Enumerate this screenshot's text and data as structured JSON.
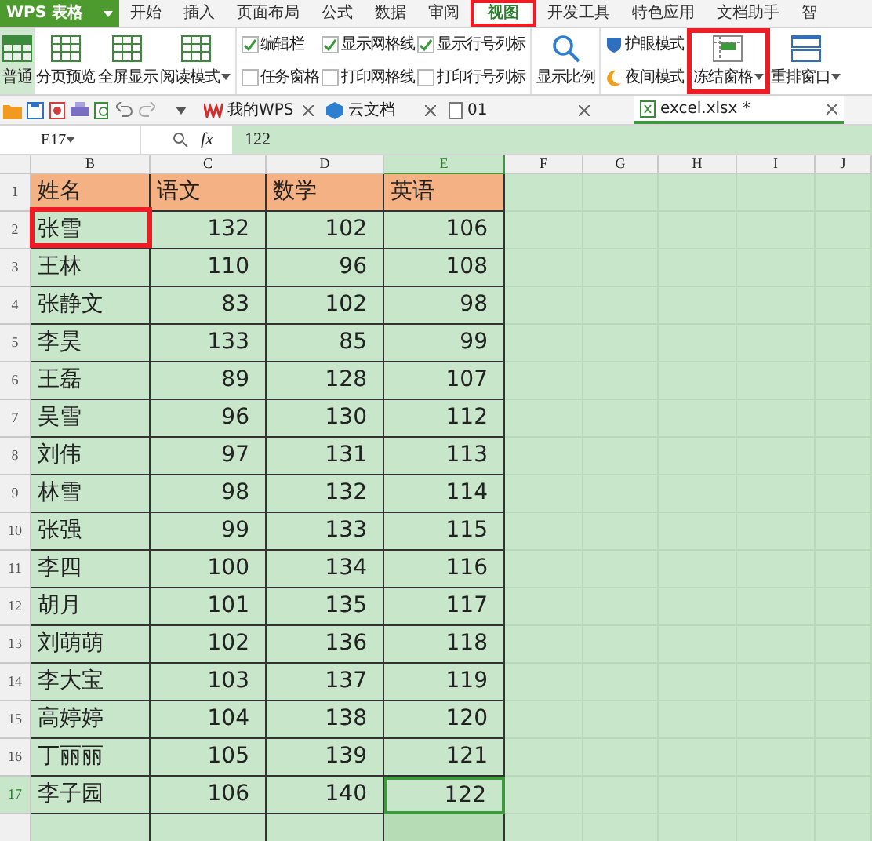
{
  "app": {
    "title": "WPS 表格"
  },
  "ribbon_tabs": [
    {
      "label": "开始",
      "selected": false
    },
    {
      "label": "插入",
      "selected": false
    },
    {
      "label": "页面布局",
      "selected": false
    },
    {
      "label": "公式",
      "selected": false
    },
    {
      "label": "数据",
      "selected": false
    },
    {
      "label": "审阅",
      "selected": false
    },
    {
      "label": "视图",
      "selected": true
    },
    {
      "label": "开发工具",
      "selected": false
    },
    {
      "label": "特色应用",
      "selected": false
    },
    {
      "label": "文档助手",
      "selected": false
    },
    {
      "label": "智",
      "selected": false
    }
  ],
  "ribbon": {
    "view_buttons": [
      {
        "label": "普通",
        "selected": true,
        "dropdown": false
      },
      {
        "label": "分页预览",
        "selected": false,
        "dropdown": false
      },
      {
        "label": "全屏显示",
        "selected": false,
        "dropdown": false
      },
      {
        "label": "阅读模式",
        "selected": false,
        "dropdown": true
      }
    ],
    "checkboxes": [
      {
        "label": "编辑栏",
        "checked": true
      },
      {
        "label": "任务窗格",
        "checked": false
      },
      {
        "label": "显示网格线",
        "checked": true
      },
      {
        "label": "打印网格线",
        "checked": false
      },
      {
        "label": "显示行号列标",
        "checked": true
      },
      {
        "label": "打印行号列标",
        "checked": false
      }
    ],
    "zoom_button": {
      "label": "显示比例"
    },
    "modes": [
      {
        "label": "护眼模式",
        "kind": "eye"
      },
      {
        "label": "夜间模式",
        "kind": "night"
      }
    ],
    "freeze_button": {
      "label": "冻结窗格"
    },
    "arrange_button": {
      "label": "重排窗口"
    }
  },
  "doc_tabs": [
    {
      "label": "我的WPS",
      "kind": "wps",
      "selected": false
    },
    {
      "label": "云文档",
      "kind": "cloud",
      "selected": false
    },
    {
      "label": "01",
      "kind": "file",
      "selected": false
    },
    {
      "label": "excel.xlsx *",
      "kind": "sheet",
      "selected": true
    }
  ],
  "formula_bar": {
    "cell": "E17",
    "function_label": "fx",
    "value": "122"
  },
  "sheet": {
    "columns": [
      {
        "label": "B",
        "selected": false
      },
      {
        "label": "C",
        "selected": false
      },
      {
        "label": "D",
        "selected": false
      },
      {
        "label": "E",
        "selected": true
      },
      {
        "label": "F",
        "selected": false
      },
      {
        "label": "G",
        "selected": false
      },
      {
        "label": "H",
        "selected": false
      },
      {
        "label": "I",
        "selected": false
      },
      {
        "label": "J",
        "selected": false
      }
    ],
    "rows": [
      {
        "number": "1",
        "selected": false,
        "kind": "header",
        "cells": [
          "姓名",
          "语文",
          "数学",
          "英语"
        ]
      },
      {
        "number": "2",
        "selected": false,
        "kind": "data",
        "cells": [
          "张雪",
          "132",
          "102",
          "106"
        ]
      },
      {
        "number": "3",
        "selected": false,
        "kind": "data",
        "cells": [
          "王林",
          "110",
          "96",
          "108"
        ]
      },
      {
        "number": "4",
        "selected": false,
        "kind": "data",
        "cells": [
          "张静文",
          "83",
          "102",
          "98"
        ]
      },
      {
        "number": "5",
        "selected": false,
        "kind": "data",
        "cells": [
          "李昊",
          "133",
          "85",
          "99"
        ]
      },
      {
        "number": "6",
        "selected": false,
        "kind": "data",
        "cells": [
          "王磊",
          "89",
          "128",
          "107"
        ]
      },
      {
        "number": "7",
        "selected": false,
        "kind": "data",
        "cells": [
          "吴雪",
          "96",
          "130",
          "112"
        ]
      },
      {
        "number": "8",
        "selected": false,
        "kind": "data",
        "cells": [
          "刘伟",
          "97",
          "131",
          "113"
        ]
      },
      {
        "number": "9",
        "selected": false,
        "kind": "data",
        "cells": [
          "林雪",
          "98",
          "132",
          "114"
        ]
      },
      {
        "number": "10",
        "selected": false,
        "kind": "data",
        "cells": [
          "张强",
          "99",
          "133",
          "115"
        ]
      },
      {
        "number": "11",
        "selected": false,
        "kind": "data",
        "cells": [
          "李四",
          "100",
          "134",
          "116"
        ]
      },
      {
        "number": "12",
        "selected": false,
        "kind": "data",
        "cells": [
          "胡月",
          "101",
          "135",
          "117"
        ]
      },
      {
        "number": "13",
        "selected": false,
        "kind": "data",
        "cells": [
          "刘萌萌",
          "102",
          "136",
          "118"
        ]
      },
      {
        "number": "14",
        "selected": false,
        "kind": "data",
        "cells": [
          "李大宝",
          "103",
          "137",
          "119"
        ]
      },
      {
        "number": "15",
        "selected": false,
        "kind": "data",
        "cells": [
          "高婷婷",
          "104",
          "138",
          "120"
        ]
      },
      {
        "number": "16",
        "selected": false,
        "kind": "data",
        "cells": [
          "丁丽丽",
          "105",
          "139",
          "121"
        ]
      },
      {
        "number": "17",
        "selected": true,
        "kind": "data",
        "cells": [
          "李子园",
          "106",
          "140",
          "122"
        ]
      }
    ]
  }
}
